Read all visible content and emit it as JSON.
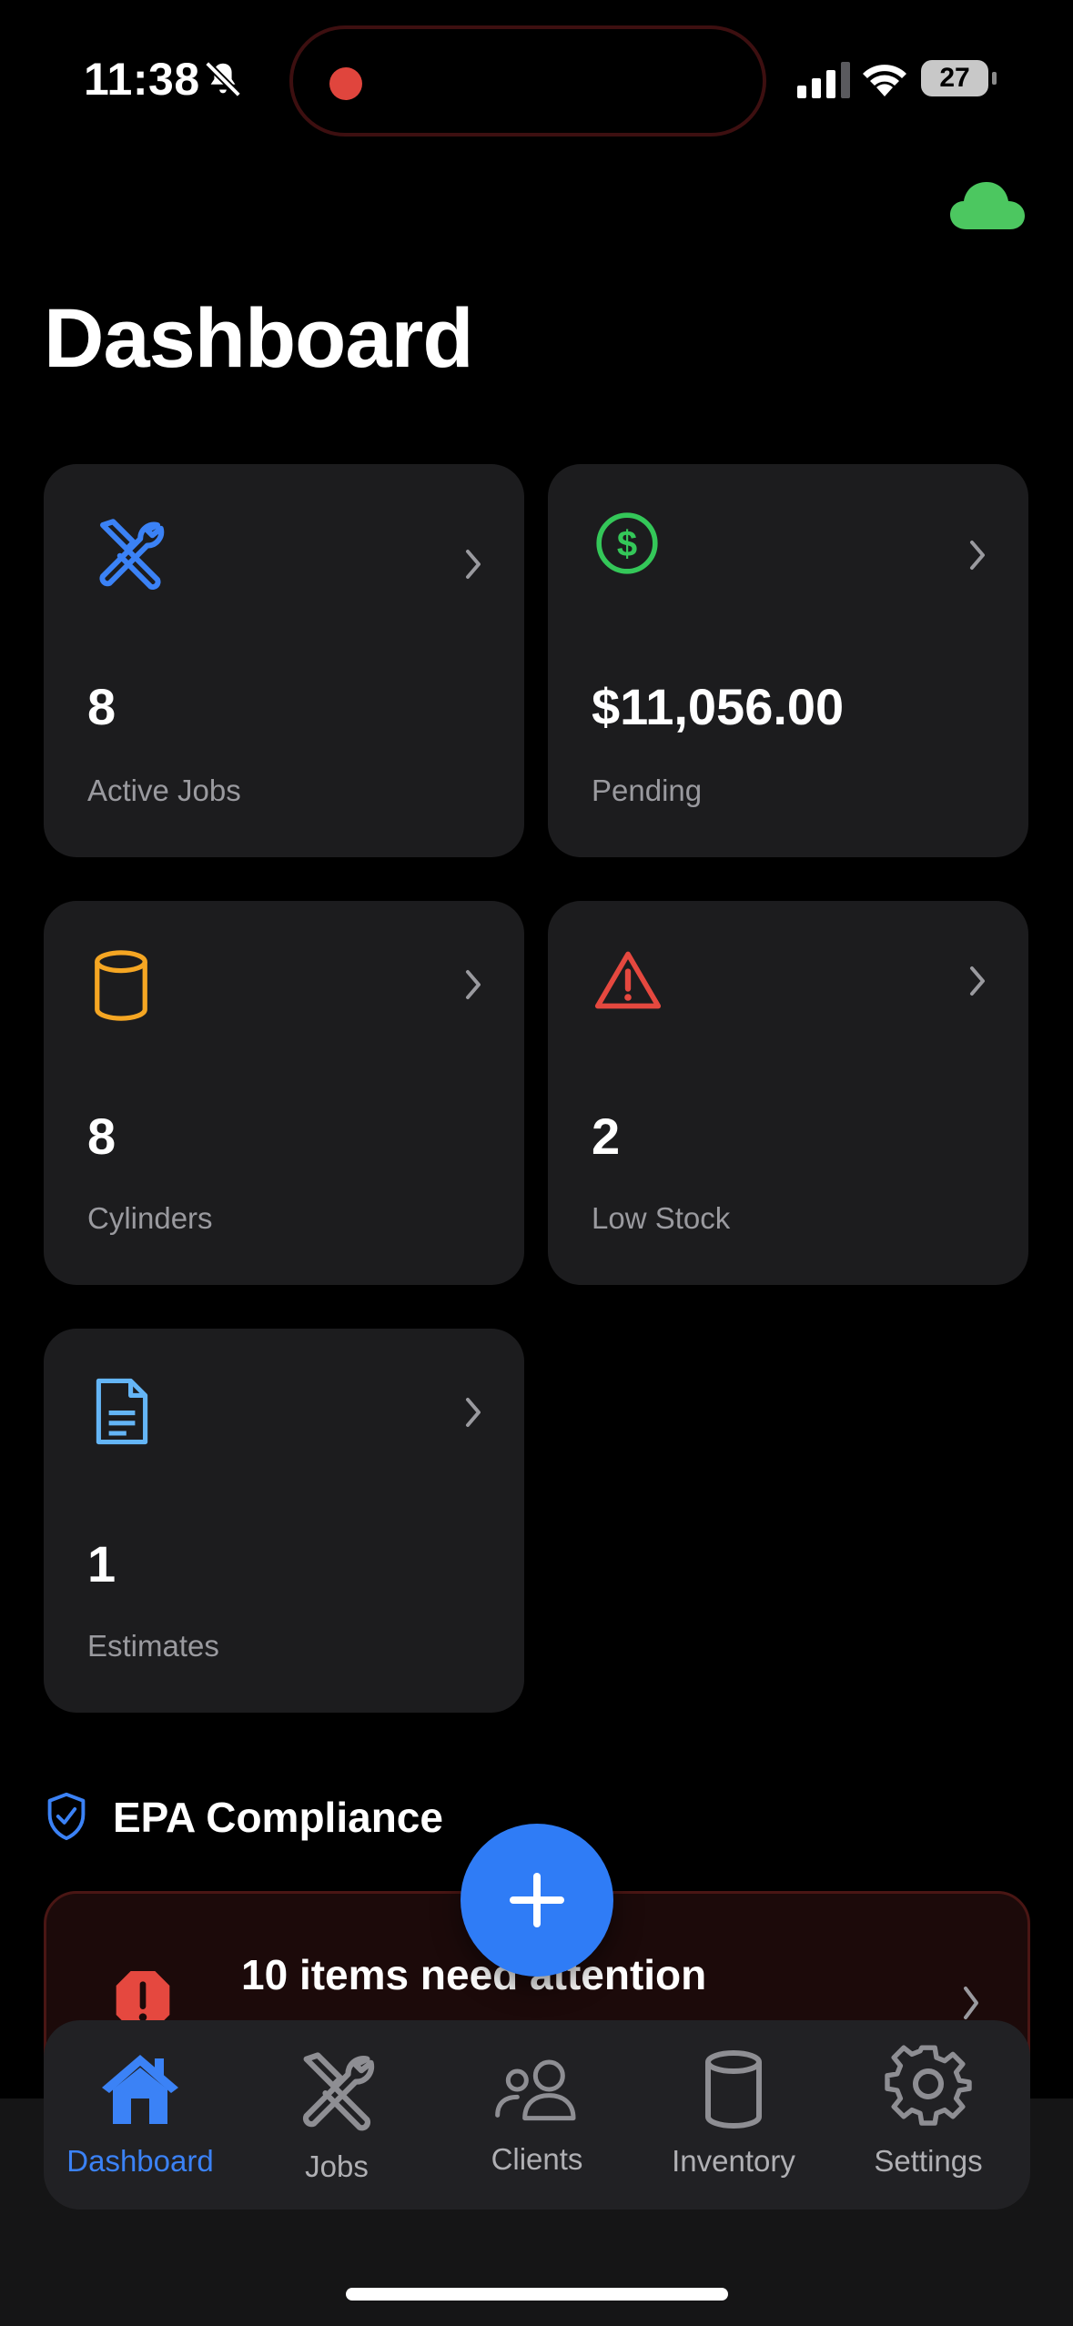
{
  "status_bar": {
    "time": "11:38",
    "battery": "27",
    "icons": [
      "bell-slash-icon",
      "signal-icon",
      "wifi-icon",
      "battery-icon"
    ]
  },
  "sync_icon": "cloud-icon",
  "page_title": "Dashboard",
  "cards": {
    "active_jobs": {
      "value": "8",
      "label": "Active Jobs",
      "icon": "wrench-screwdriver-icon",
      "color": "#3b82f6"
    },
    "pending": {
      "value": "$11,056.00",
      "label": "Pending",
      "icon": "dollar-circle-icon",
      "color": "#34c759"
    },
    "cylinders": {
      "value": "8",
      "label": "Cylinders",
      "icon": "cylinder-icon",
      "color": "#f5a623"
    },
    "low_stock": {
      "value": "2",
      "label": "Low Stock",
      "icon": "warning-triangle-icon",
      "color": "#e5483f"
    },
    "estimates": {
      "value": "1",
      "label": "Estimates",
      "icon": "document-icon",
      "color": "#64b5f6"
    }
  },
  "epa": {
    "title": "EPA Compliance",
    "alert_text": "10 items need attention",
    "alert_color": "#e5483f"
  },
  "fab": {
    "icon": "plus-icon",
    "color": "#2f7cf6"
  },
  "tabs": [
    {
      "label": "Dashboard",
      "icon": "house-icon",
      "active": true
    },
    {
      "label": "Jobs",
      "icon": "wrench-screwdriver-icon",
      "active": false
    },
    {
      "label": "Clients",
      "icon": "people-icon",
      "active": false
    },
    {
      "label": "Inventory",
      "icon": "cylinder-icon",
      "active": false
    },
    {
      "label": "Settings",
      "icon": "gear-icon",
      "active": false
    }
  ]
}
